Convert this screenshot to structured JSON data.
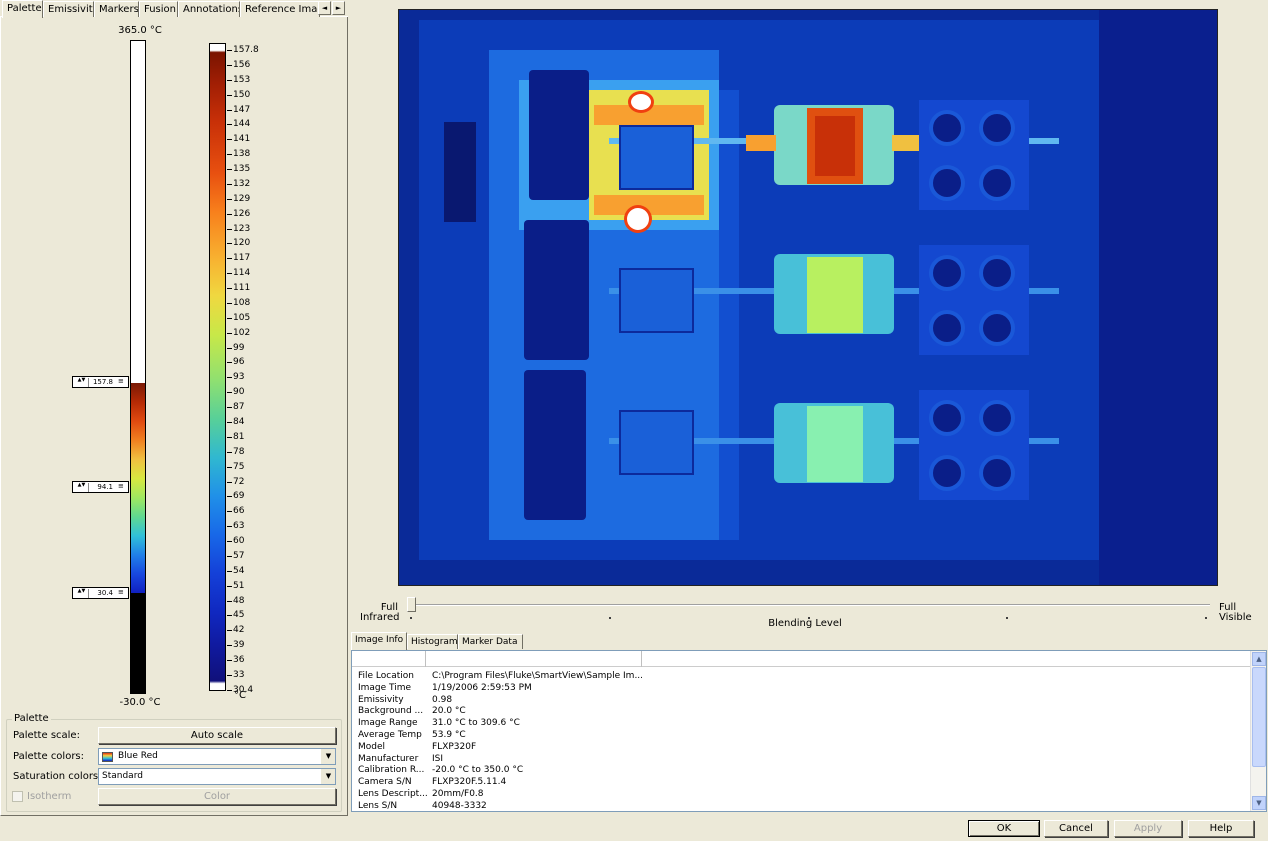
{
  "left_tabs": [
    "Palette",
    "Emissivity",
    "Markers",
    "Fusion",
    "Annotations",
    "Reference Image"
  ],
  "tab_scroll": {
    "left": "◄",
    "right": "►"
  },
  "palette_bar": {
    "top_label": "365.0 °C",
    "bottom_label": "-30.0 °C",
    "markers": [
      {
        "value": "157.8",
        "spin": "▲▼",
        "handle": "≡"
      },
      {
        "value": "94.1",
        "spin": "▲▼",
        "handle": "≡"
      },
      {
        "value": "30.4",
        "spin": "▲▼",
        "handle": "≡"
      }
    ]
  },
  "scale": {
    "ticks": [
      "157.8",
      "156",
      "153",
      "150",
      "147",
      "144",
      "141",
      "138",
      "135",
      "132",
      "129",
      "126",
      "123",
      "120",
      "117",
      "114",
      "111",
      "108",
      "105",
      "102",
      "99",
      "96",
      "93",
      "90",
      "87",
      "84",
      "81",
      "78",
      "75",
      "72",
      "69",
      "66",
      "63",
      "60",
      "57",
      "54",
      "51",
      "48",
      "45",
      "42",
      "39",
      "36",
      "33",
      "30.4"
    ],
    "unit": "°C"
  },
  "palette_group": {
    "title": "Palette",
    "scale_label": "Palette scale:",
    "auto_scale_button": "Auto scale",
    "colors_label": "Palette colors:",
    "colors_value": "Blue Red",
    "saturation_label": "Saturation colors:",
    "saturation_value": "Standard",
    "isotherm_label": "Isotherm",
    "color_button": "Color"
  },
  "blending": {
    "left_top": "Full",
    "left_bottom": "Infrared",
    "center": "Blending Level",
    "right_top": "Full",
    "right_bottom": "Visible"
  },
  "bottom_tabs": [
    "Image Info",
    "Histogram",
    "Marker Data"
  ],
  "image_info": [
    {
      "key": "File Location",
      "value": "C:\\Program Files\\Fluke\\SmartView\\Sample Im..."
    },
    {
      "key": "Image Time",
      "value": "1/19/2006 2:59:53 PM"
    },
    {
      "key": "Emissivity",
      "value": "0.98"
    },
    {
      "key": "Background ...",
      "value": "20.0 °C"
    },
    {
      "key": "Image Range",
      "value": "31.0 °C to 309.6 °C"
    },
    {
      "key": "Average Temp",
      "value": "53.9 °C"
    },
    {
      "key": "Model",
      "value": "FLXP320F"
    },
    {
      "key": "Manufacturer",
      "value": "ISI"
    },
    {
      "key": "Calibration R...",
      "value": "-20.0 °C to 350.0 °C"
    },
    {
      "key": "Camera S/N",
      "value": "FLXP320F.5.11.4"
    },
    {
      "key": "Lens Descript...",
      "value": "20mm/F0.8"
    },
    {
      "key": "Lens S/N",
      "value": "40948-3332"
    }
  ],
  "scroll": {
    "up": "▲",
    "down": "▼"
  },
  "dialog_buttons": {
    "ok": "OK",
    "cancel": "Cancel",
    "apply": "Apply",
    "help": "Help"
  },
  "colors": {
    "window_bg": "#ece9d8",
    "hot": "#e04a10",
    "cool": "#1848e0"
  }
}
